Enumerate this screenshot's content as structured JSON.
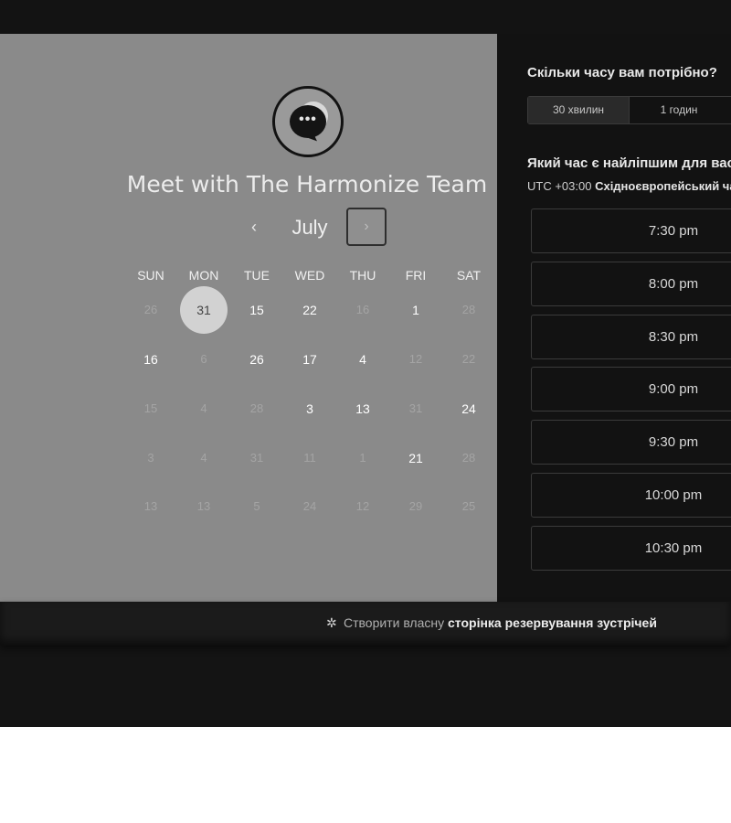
{
  "booking": {
    "title": "Meet with The Harmonize Team",
    "month": "July",
    "prev_icon": "‹",
    "next_icon": "›",
    "weekdays": [
      "SUN",
      "MON",
      "TUE",
      "WED",
      "THU",
      "FRI",
      "SAT"
    ],
    "days": [
      [
        "26",
        "31",
        "15",
        "22",
        "16",
        "1",
        "28"
      ],
      [
        "16",
        "6",
        "26",
        "17",
        "4",
        "12",
        "22"
      ],
      [
        "15",
        "4",
        "28",
        "3",
        "13",
        "31",
        "24"
      ],
      [
        "3",
        "4",
        "31",
        "11",
        "1",
        "21",
        "28"
      ],
      [
        "13",
        "13",
        "5",
        "24",
        "12",
        "29",
        "25"
      ]
    ],
    "selected_day": "31",
    "logo_icon": "chat-bubble-icon"
  },
  "scheduler": {
    "duration_question": "Скільки часу вам потрібно?",
    "durations": [
      "30 хвилин",
      "1 годин"
    ],
    "selected_duration": "30 хвилин",
    "time_question": "Який час є найліпшим для вас?",
    "timezone_offset": "UTC +03:00",
    "timezone_name": "Східноєвропейський час",
    "slots": [
      "7:30 pm",
      "8:00 pm",
      "8:30 pm",
      "9:00 pm",
      "9:30 pm",
      "10:00 pm",
      "10:30 pm"
    ]
  },
  "footer": {
    "prefix": "Створити власну",
    "link": "сторінка резервування зустрічей",
    "icon": "hubspot-sprocket-icon"
  }
}
